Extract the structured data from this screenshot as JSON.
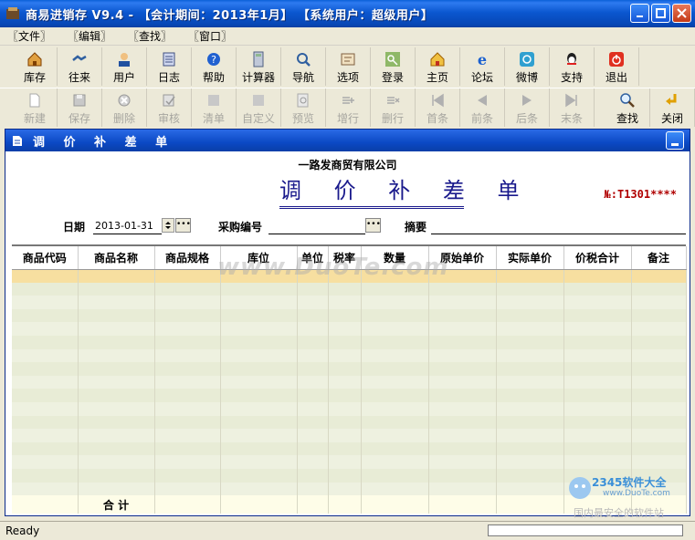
{
  "window": {
    "title": "商易进销存 V9.4 - 【会计期间：2013年1月】 【系统用户：超级用户】"
  },
  "menu": [
    "〖文件〗",
    "〖编辑〗",
    "〖查找〗",
    "〖窗口〗"
  ],
  "toolbar_main": [
    {
      "label": "库存",
      "icon": "home-icon"
    },
    {
      "label": "往来",
      "icon": "handshake-icon"
    },
    {
      "label": "用户",
      "icon": "user-icon"
    },
    {
      "label": "日志",
      "icon": "log-icon"
    },
    {
      "label": "帮助",
      "icon": "help-icon"
    },
    {
      "label": "计算器",
      "icon": "calculator-icon"
    },
    {
      "label": "导航",
      "icon": "navigation-icon"
    },
    {
      "label": "选项",
      "icon": "options-icon"
    },
    {
      "label": "登录",
      "icon": "key-icon"
    },
    {
      "label": "主页",
      "icon": "homepage-icon"
    },
    {
      "label": "论坛",
      "icon": "ie-icon"
    },
    {
      "label": "微博",
      "icon": "weibo-icon"
    },
    {
      "label": "支持",
      "icon": "qq-icon"
    },
    {
      "label": "退出",
      "icon": "power-icon"
    }
  ],
  "toolbar_doc": [
    {
      "label": "新建",
      "icon": "new-icon",
      "enabled": false
    },
    {
      "label": "保存",
      "icon": "save-icon",
      "enabled": false
    },
    {
      "label": "删除",
      "icon": "delete-icon",
      "enabled": false
    },
    {
      "label": "审核",
      "icon": "audit-icon",
      "enabled": false
    },
    {
      "label": "清单",
      "icon": "list-icon",
      "enabled": false
    },
    {
      "label": "自定义",
      "icon": "custom-icon",
      "enabled": false
    },
    {
      "label": "预览",
      "icon": "preview-icon",
      "enabled": false
    },
    {
      "label": "增行",
      "icon": "add-row-icon",
      "enabled": false
    },
    {
      "label": "删行",
      "icon": "delete-row-icon",
      "enabled": false
    },
    {
      "label": "首条",
      "icon": "first-icon",
      "enabled": false
    },
    {
      "label": "前条",
      "icon": "prev-icon",
      "enabled": false
    },
    {
      "label": "后条",
      "icon": "next-icon",
      "enabled": false
    },
    {
      "label": "末条",
      "icon": "last-icon",
      "enabled": false
    },
    {
      "label": "查找",
      "icon": "search-icon",
      "enabled": true
    },
    {
      "label": "关闭",
      "icon": "close-doc-icon",
      "enabled": true
    }
  ],
  "doc": {
    "window_title": "调 价 补 差 单",
    "company": "一路发商贸有限公司",
    "title": "调 价 补 差 单",
    "doc_no": "№:T1301****",
    "date_label": "日期",
    "date_value": "2013-01-31",
    "purchase_no_label": "采购编号",
    "purchase_no_value": "",
    "summary_label": "摘要",
    "summary_value": ""
  },
  "table": {
    "columns": [
      "商品代码",
      "商品名称",
      "商品规格",
      "库位",
      "单位",
      "税率",
      "数量",
      "原始单价",
      "实际单价",
      "价税合计",
      "备注"
    ],
    "total_label": "合 计"
  },
  "status": {
    "text": "Ready"
  },
  "overlay": {
    "watermark": "www.DuoTe.com",
    "brand_name": "2345软件大全",
    "brand_url": "www.DuoTe.com",
    "brand_slogan": "国内最安全的软件站"
  },
  "colors": {
    "titlebar": "#0b57d0",
    "selected_row": "#f7dfa0",
    "doc_title": "#1a1a8c",
    "doc_no": "#b00000"
  }
}
